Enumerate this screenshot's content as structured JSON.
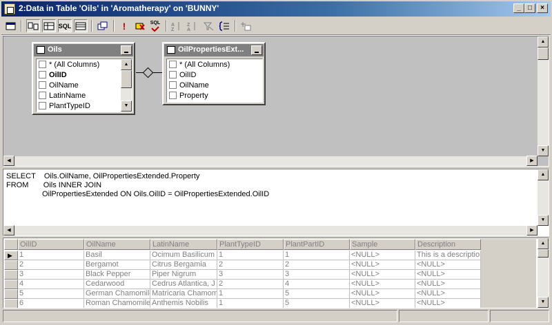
{
  "window": {
    "title": "2:Data in Table 'Oils' in 'Aromatherapy' on 'BUNNY'",
    "controls": {
      "minimize": "_",
      "maximize": "□",
      "close": "×"
    }
  },
  "toolbar": {
    "icons": [
      "properties-icon",
      "diagram-pane-icon",
      "grid-pane-icon",
      "sql-pane-icon",
      "results-pane-icon",
      "change-query-type-icon",
      "run-icon",
      "cancel-query-icon",
      "verify-sql-icon",
      "sort-ascending-icon",
      "sort-descending-icon",
      "remove-filter-icon",
      "group-by-icon",
      "add-table-icon"
    ],
    "sql_label": "SQL",
    "sql_check_label": "SQL"
  },
  "diagram": {
    "tables": [
      {
        "name": "Oils",
        "columns": [
          "* (All Columns)",
          "OilID",
          "OilName",
          "LatinName",
          "PlantTypeID"
        ]
      },
      {
        "name": "OilPropertiesExt...",
        "columns": [
          "* (All Columns)",
          "OilID",
          "OilName",
          "Property"
        ]
      }
    ]
  },
  "sql": {
    "lines": [
      "SELECT    Oils.OilName, OilPropertiesExtended.Property",
      "FROM       Oils INNER JOIN",
      "                 OilPropertiesExtended ON Oils.OilID = OilPropertiesExtended.OilID"
    ]
  },
  "grid": {
    "columns": [
      "OilID",
      "OilName",
      "LatinName",
      "PlantTypeID",
      "PlantPartID",
      "Sample",
      "Description"
    ],
    "rows": [
      [
        "1",
        "Basil",
        "Ocimum Basilicum",
        "1",
        "1",
        "<NULL>",
        "This is a description"
      ],
      [
        "2",
        "Bergamot",
        "Citrus Bergamia",
        "2",
        "2",
        "<NULL>",
        "<NULL>"
      ],
      [
        "3",
        "Black Pepper",
        "Piper Nigrum",
        "3",
        "3",
        "<NULL>",
        "<NULL>"
      ],
      [
        "4",
        "Cedarwood",
        "Cedrus Atlantica, J",
        "2",
        "4",
        "<NULL>",
        "<NULL>"
      ],
      [
        "5",
        "German Chamomile",
        "Matricaria Chamom",
        "1",
        "5",
        "<NULL>",
        "<NULL>"
      ],
      [
        "6",
        "Roman Chamomile",
        "Anthemis Nobilis",
        "1",
        "5",
        "<NULL>",
        "<NULL>"
      ]
    ],
    "current_row_marker": "▶"
  }
}
